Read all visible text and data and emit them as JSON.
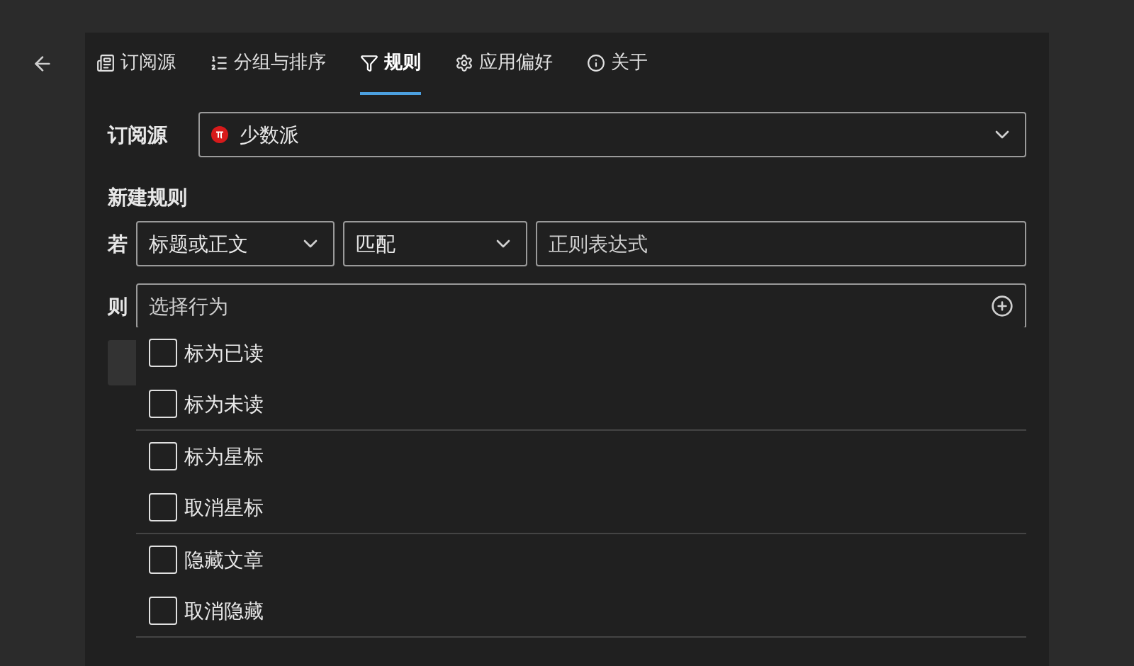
{
  "tabs": [
    {
      "label": "订阅源",
      "kind": "feeds",
      "selected": false
    },
    {
      "label": "分组与排序",
      "kind": "list",
      "selected": false
    },
    {
      "label": "规则",
      "kind": "filter",
      "selected": true
    },
    {
      "label": "应用偏好",
      "kind": "gear",
      "selected": false
    },
    {
      "label": "关于",
      "kind": "info",
      "selected": false
    }
  ],
  "source": {
    "label": "订阅源",
    "value": "少数派"
  },
  "new_rule": {
    "title": "新建规则",
    "if_label": "若",
    "field": "标题或正文",
    "operator": "匹配",
    "pattern_placeholder": "正则表达式",
    "then_label": "则",
    "action_placeholder": "选择行为"
  },
  "action_groups": [
    [
      {
        "label": "标为已读",
        "checked": false
      },
      {
        "label": "标为未读",
        "checked": false
      }
    ],
    [
      {
        "label": "标为星标",
        "checked": false
      },
      {
        "label": "取消星标",
        "checked": false
      }
    ],
    [
      {
        "label": "隐藏文章",
        "checked": false
      },
      {
        "label": "取消隐藏",
        "checked": false
      }
    ]
  ]
}
